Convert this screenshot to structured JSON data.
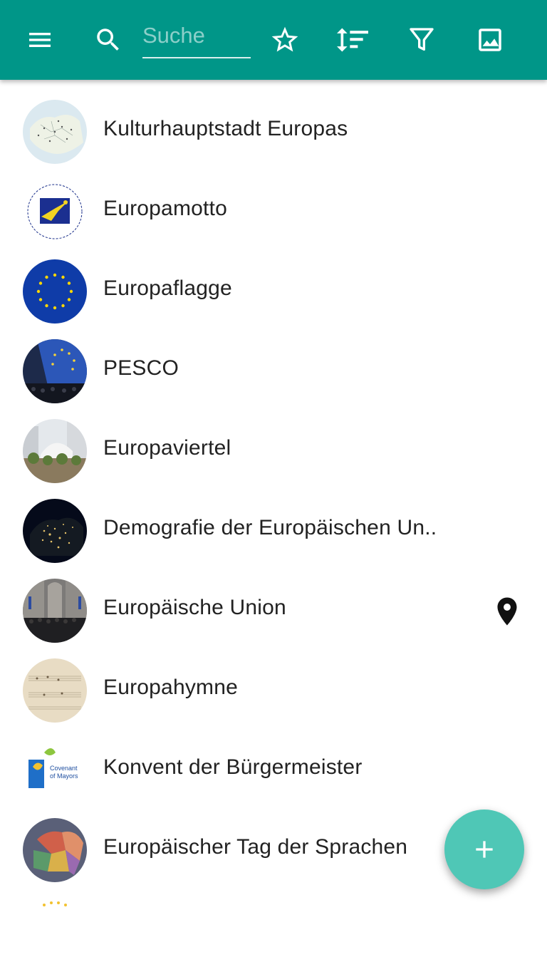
{
  "colors": {
    "appbar": "#009688",
    "fab": "#4fc7b6",
    "text": "#222222"
  },
  "toolbar": {
    "menu_icon": "menu-icon",
    "search_icon": "search-icon",
    "search_placeholder": "Suche",
    "search_value": "",
    "favorite_icon": "star-outline-icon",
    "sort_icon": "sort-icon",
    "filter_icon": "filter-icon",
    "image_icon": "image-icon"
  },
  "items": [
    {
      "label": "Kulturhauptstadt Europas",
      "thumb": "europe-map-thumbnail"
    },
    {
      "label": "Europamotto",
      "thumb": "motto-for-europe-logo"
    },
    {
      "label": "Europaflagge",
      "thumb": "eu-flag"
    },
    {
      "label": "PESCO",
      "thumb": "eu-flag-photo"
    },
    {
      "label": "Europaviertel",
      "thumb": "building-photo"
    },
    {
      "label": "Demografie der Europäischen Un..",
      "thumb": "europe-night-lights"
    },
    {
      "label": "Europäische Union",
      "thumb": "group-photo",
      "marker_icon": "location-pin-icon"
    },
    {
      "label": "Europahymne",
      "thumb": "sheet-music"
    },
    {
      "label": "Konvent der Bürgermeister",
      "thumb": "covenant-of-mayors-logo"
    },
    {
      "label": "Europäischer Tag der Sprachen",
      "thumb": "europe-language-map"
    }
  ],
  "fab": {
    "icon": "add-icon"
  }
}
